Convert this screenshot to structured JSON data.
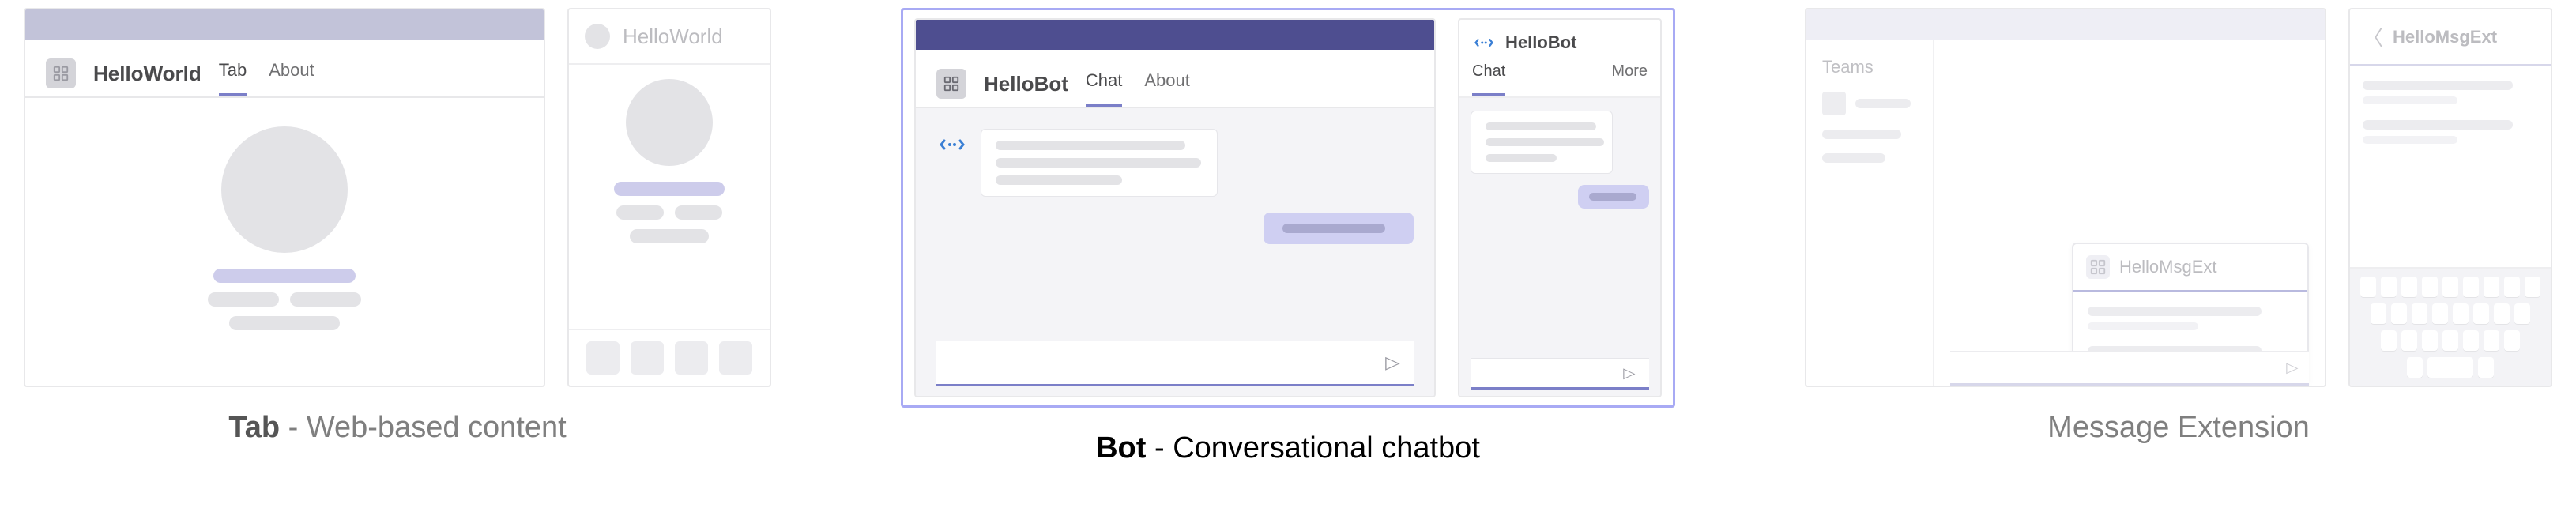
{
  "colors": {
    "accent": "#7b7fc8",
    "selected_border": "#a8aaf4",
    "titlebar_gray": "#c2c3d9",
    "titlebar_dark": "#4e4e90",
    "faded_text": "#bcbcc0"
  },
  "panels": {
    "tab": {
      "caption_bold": "Tab",
      "caption_rest": " - Web-based content",
      "desktop": {
        "app_name": "HelloWorld",
        "tabs": [
          {
            "label": "Tab",
            "active": true
          },
          {
            "label": "About",
            "active": false
          }
        ]
      },
      "mobile": {
        "title": "HelloWorld"
      }
    },
    "bot": {
      "caption_bold": "Bot",
      "caption_rest": " - Conversational chatbot",
      "desktop": {
        "app_name": "HelloBot",
        "tabs": [
          {
            "label": "Chat",
            "active": true
          },
          {
            "label": "About",
            "active": false
          }
        ]
      },
      "mobile": {
        "app_name": "HelloBot",
        "tabs": [
          {
            "label": "Chat",
            "active": true
          },
          {
            "label": "More",
            "active": false
          }
        ]
      }
    },
    "ext": {
      "caption": "Message Extension",
      "desktop": {
        "rail_title": "Teams",
        "popup_name": "HelloMsgExt"
      },
      "mobile": {
        "title": "HelloMsgExt"
      }
    }
  }
}
